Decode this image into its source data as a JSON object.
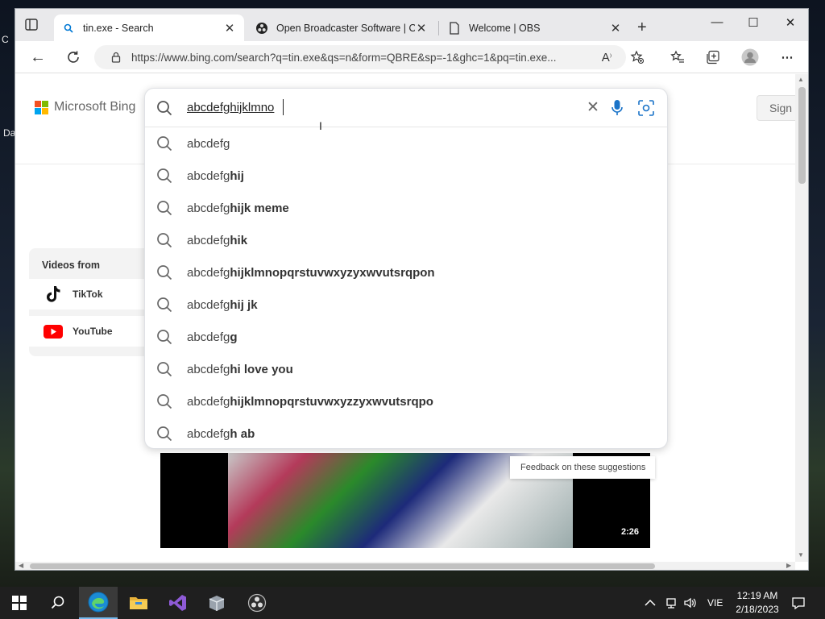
{
  "browser": {
    "tabs": [
      {
        "title": "tin.exe - Search",
        "active": true,
        "icon": "bing-search-icon"
      },
      {
        "title": "Open Broadcaster Software | OBS",
        "active": false,
        "icon": "obs-icon"
      },
      {
        "title": "Welcome | OBS",
        "active": false,
        "icon": "page-icon"
      }
    ],
    "url": "https://www.bing.com/search?q=tin.exe&qs=n&form=QBRE&sp=-1&ghc=1&pq=tin.exe..."
  },
  "page": {
    "logo_text": "Microsoft Bing",
    "signin_label": "Sign i",
    "search": {
      "query": "abcdefghijklmno",
      "suggestions": [
        {
          "prefix": "abcdefg",
          "bold": ""
        },
        {
          "prefix": "abcdefg",
          "bold": "hij"
        },
        {
          "prefix": "abcdefg",
          "bold": "hijk meme"
        },
        {
          "prefix": "abcdefg",
          "bold": "hik"
        },
        {
          "prefix": "abcdefg",
          "bold": "hijklmnopqrstuvwxyzyxwvutsrqpon"
        },
        {
          "prefix": "abcdefg",
          "bold": "hij jk"
        },
        {
          "prefix": "abcdefg",
          "bold": "g"
        },
        {
          "prefix": "abcdefg",
          "bold": "hi love you"
        },
        {
          "prefix": "abcdefg",
          "bold": "hijklmnopqrstuvwxyzzyxwvutsrqpo"
        },
        {
          "prefix": "abcdefg",
          "bold": "h ab"
        }
      ],
      "feedback_label": "Feedback on these suggestions"
    },
    "videos_from": {
      "heading": "Videos from",
      "sources": [
        {
          "label": "TikTok",
          "icon": "tiktok-icon"
        },
        {
          "label": "YouTube",
          "icon": "youtube-icon"
        }
      ]
    },
    "video": {
      "duration": "2:26"
    }
  },
  "desktop": {
    "fragment_1": "C",
    "fragment_2": "Da"
  },
  "taskbar": {
    "lang": "VIE",
    "time": "12:19 AM",
    "date": "2/18/2023"
  },
  "colors": {
    "edge_accent": "#0078d4",
    "taskbar_bg": "#1f1f1f",
    "youtube_red": "#ff0000",
    "ms_red": "#f25022",
    "ms_green": "#7fba00",
    "ms_blue": "#00a4ef",
    "ms_yellow": "#ffb900"
  }
}
